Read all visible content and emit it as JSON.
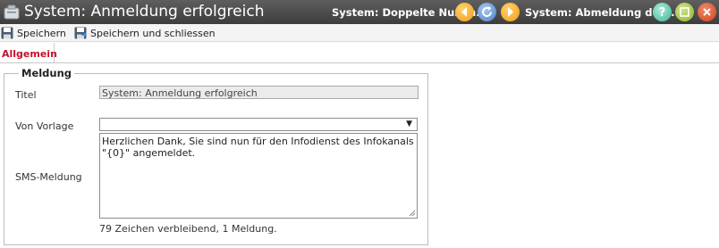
{
  "window": {
    "title": "System: Anmeldung erfolgreich",
    "prev_record": "System: Doppelte Numm...",
    "next_record": "System: Abmeldung durc..."
  },
  "toolbar": {
    "save_label": "Speichern",
    "save_close_label": "Speichern und schliessen"
  },
  "tabs": [
    {
      "label": "Allgemein",
      "active": true
    }
  ],
  "form": {
    "group_title": "Meldung",
    "titel_label": "Titel",
    "titel_value": "System: Anmeldung erfolgreich",
    "vorlage_label": "Von Vorlage",
    "vorlage_value": "",
    "sms_label": "SMS-Meldung",
    "sms_value": "Herzlichen Dank, Sie sind nun für den Infodienst des Infokanals \"{0}\" angemeldet.",
    "counter": "79 Zeichen verbleibend, 1 Meldung."
  },
  "colors": {
    "titlebar": "#4a4a4a",
    "active_tab": "#c8102e"
  },
  "icons": [
    "app-icon",
    "prev-icon",
    "refresh-icon",
    "next-icon",
    "help-icon",
    "maximize-icon",
    "close-icon",
    "save-icon",
    "save-close-icon",
    "dropdown-arrow-icon",
    "resize-grip-icon"
  ]
}
